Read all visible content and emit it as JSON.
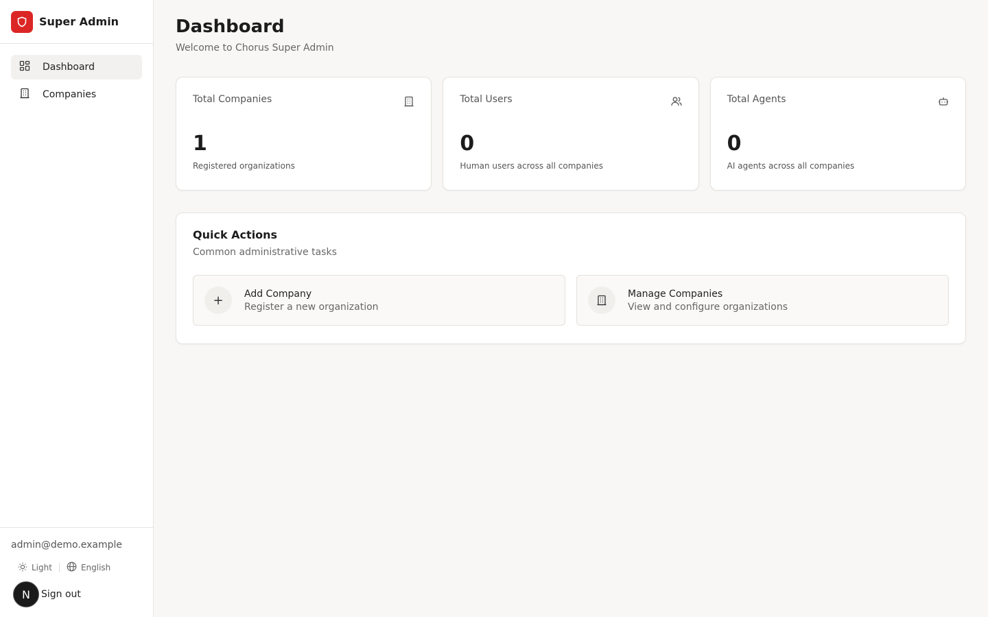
{
  "brand": {
    "title": "Super Admin",
    "logo_icon": "shield-icon",
    "accent": "#dc2626"
  },
  "nav": {
    "items": [
      {
        "label": "Dashboard",
        "icon": "dashboard-grid-icon",
        "active": true
      },
      {
        "label": "Companies",
        "icon": "building-icon",
        "active": false
      }
    ]
  },
  "footer": {
    "email": "admin@demo.example",
    "theme_label": "Light",
    "language_label": "English",
    "avatar_letter": "N",
    "signout_label": "Sign out"
  },
  "header": {
    "title": "Dashboard",
    "subtitle": "Welcome to Chorus Super Admin"
  },
  "stats": [
    {
      "label": "Total Companies",
      "value": "1",
      "description": "Registered organizations",
      "icon": "building-icon"
    },
    {
      "label": "Total Users",
      "value": "0",
      "description": "Human users across all companies",
      "icon": "users-icon"
    },
    {
      "label": "Total Agents",
      "value": "0",
      "description": "AI agents across all companies",
      "icon": "bot-icon"
    }
  ],
  "quick_actions": {
    "title": "Quick Actions",
    "subtitle": "Common administrative tasks",
    "items": [
      {
        "title": "Add Company",
        "description": "Register a new organization",
        "icon": "plus-icon",
        "glyph": "+"
      },
      {
        "title": "Manage Companies",
        "description": "View and configure organizations",
        "icon": "building-icon"
      }
    ]
  }
}
